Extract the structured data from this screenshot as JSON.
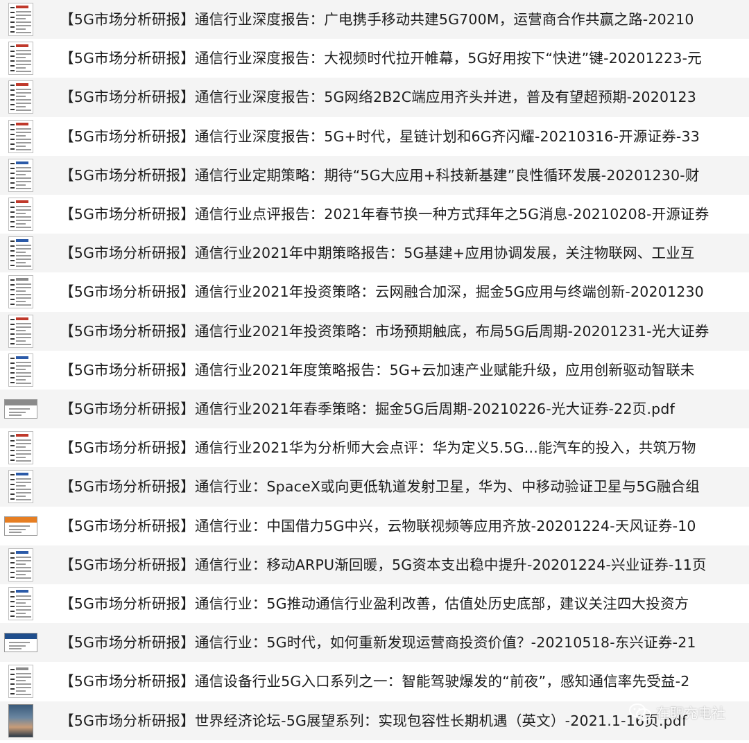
{
  "files": [
    {
      "name": "【5G市场分析研报】通信行业深度报告：广电携手移动共建5G700M，运营商合作共赢之路-20210",
      "thumb": "doc",
      "accent": "#c0392b"
    },
    {
      "name": "【5G市场分析研报】通信行业深度报告：大视频时代拉开帷幕，5G好用按下“快进”键-20201223-元",
      "thumb": "doc",
      "accent": "#c0392b"
    },
    {
      "name": "【5G市场分析研报】通信行业深度报告：5G网络2B2C端应用齐头并进，普及有望超预期-2020123",
      "thumb": "doc",
      "accent": "#c0392b"
    },
    {
      "name": "【5G市场分析研报】通信行业深度报告：5G+时代，星链计划和6G齐闪耀-20210316-开源证券-33",
      "thumb": "doc",
      "accent": "#c0392b"
    },
    {
      "name": "【5G市场分析研报】通信行业定期策略：期待“5G大应用+科技新基建”良性循环发展-20201230-财",
      "thumb": "doc",
      "accent": "#2b5aa8"
    },
    {
      "name": "【5G市场分析研报】通信行业点评报告：2021年春节换一种方式拜年之5G消息-20210208-开源证券",
      "thumb": "doc",
      "accent": "#c0392b"
    },
    {
      "name": "【5G市场分析研报】通信行业2021年中期策略报告：5G基建+应用协调发展，关注物联网、工业互",
      "thumb": "doc",
      "accent": "#2b5aa8"
    },
    {
      "name": "【5G市场分析研报】通信行业2021年投资策略：云网融合加深，掘金5G应用与终端创新-20201230",
      "thumb": "doc",
      "accent": "#8a8a8a"
    },
    {
      "name": "【5G市场分析研报】通信行业2021年投资策略：市场预期触底，布局5G后周期-20201231-光大证券",
      "thumb": "doc",
      "accent": "#c0392b"
    },
    {
      "name": "【5G市场分析研报】通信行业2021年度策略报告：5G+云加速产业赋能升级，应用创新驱动智联未",
      "thumb": "doc",
      "accent": "#2b5aa8"
    },
    {
      "name": "【5G市场分析研报】通信行业2021年春季策略：掘金5G后周期-20210226-光大证券-22页.pdf",
      "thumb": "landscape",
      "accent": "#8a8a8a"
    },
    {
      "name": "【5G市场分析研报】通信行业2021华为分析师大会点评：华为定义5.5G...能汽车的投入，共筑万物",
      "thumb": "doc",
      "accent": "#c0392b"
    },
    {
      "name": "【5G市场分析研报】通信行业：SpaceX或向更低轨道发射卫星，华为、中移动验证卫星与5G融合组",
      "thumb": "doc",
      "accent": "#2b5aa8"
    },
    {
      "name": "【5G市场分析研报】通信行业：中国借力5G中兴，云物联视频等应用齐放-20201224-天风证券-10",
      "thumb": "landscape",
      "accent": "#e67e22"
    },
    {
      "name": "【5G市场分析研报】通信行业：移动ARPU渐回暖，5G资本支出稳中提升-20201224-兴业证券-11页",
      "thumb": "doc",
      "accent": "#2b5aa8"
    },
    {
      "name": "【5G市场分析研报】通信行业：5G推动通信行业盈利改善，估值处历史底部，建议关注四大投资方",
      "thumb": "doc",
      "accent": "#2b5aa8"
    },
    {
      "name": "【5G市场分析研报】通信行业：5G时代，如何重新发现运营商投资价值？-20210518-东兴证券-21",
      "thumb": "landscape",
      "accent": "#1f4e8c"
    },
    {
      "name": "【5G市场分析研报】通信设备行业5G入口系列之一：智能驾驶爆发的“前夜”，感知通信率先受益-2",
      "thumb": "doc",
      "accent": "#8a8a8a"
    },
    {
      "name": "【5G市场分析研报】世界经济论坛-5G展望系列：实现包容性长期机遇（英文）-2021.1-16页.pdf",
      "thumb": "photo",
      "accent": "#3a5a7a"
    }
  ],
  "watermark": {
    "text": "在职充电社",
    "icon": "wechat-icon"
  }
}
